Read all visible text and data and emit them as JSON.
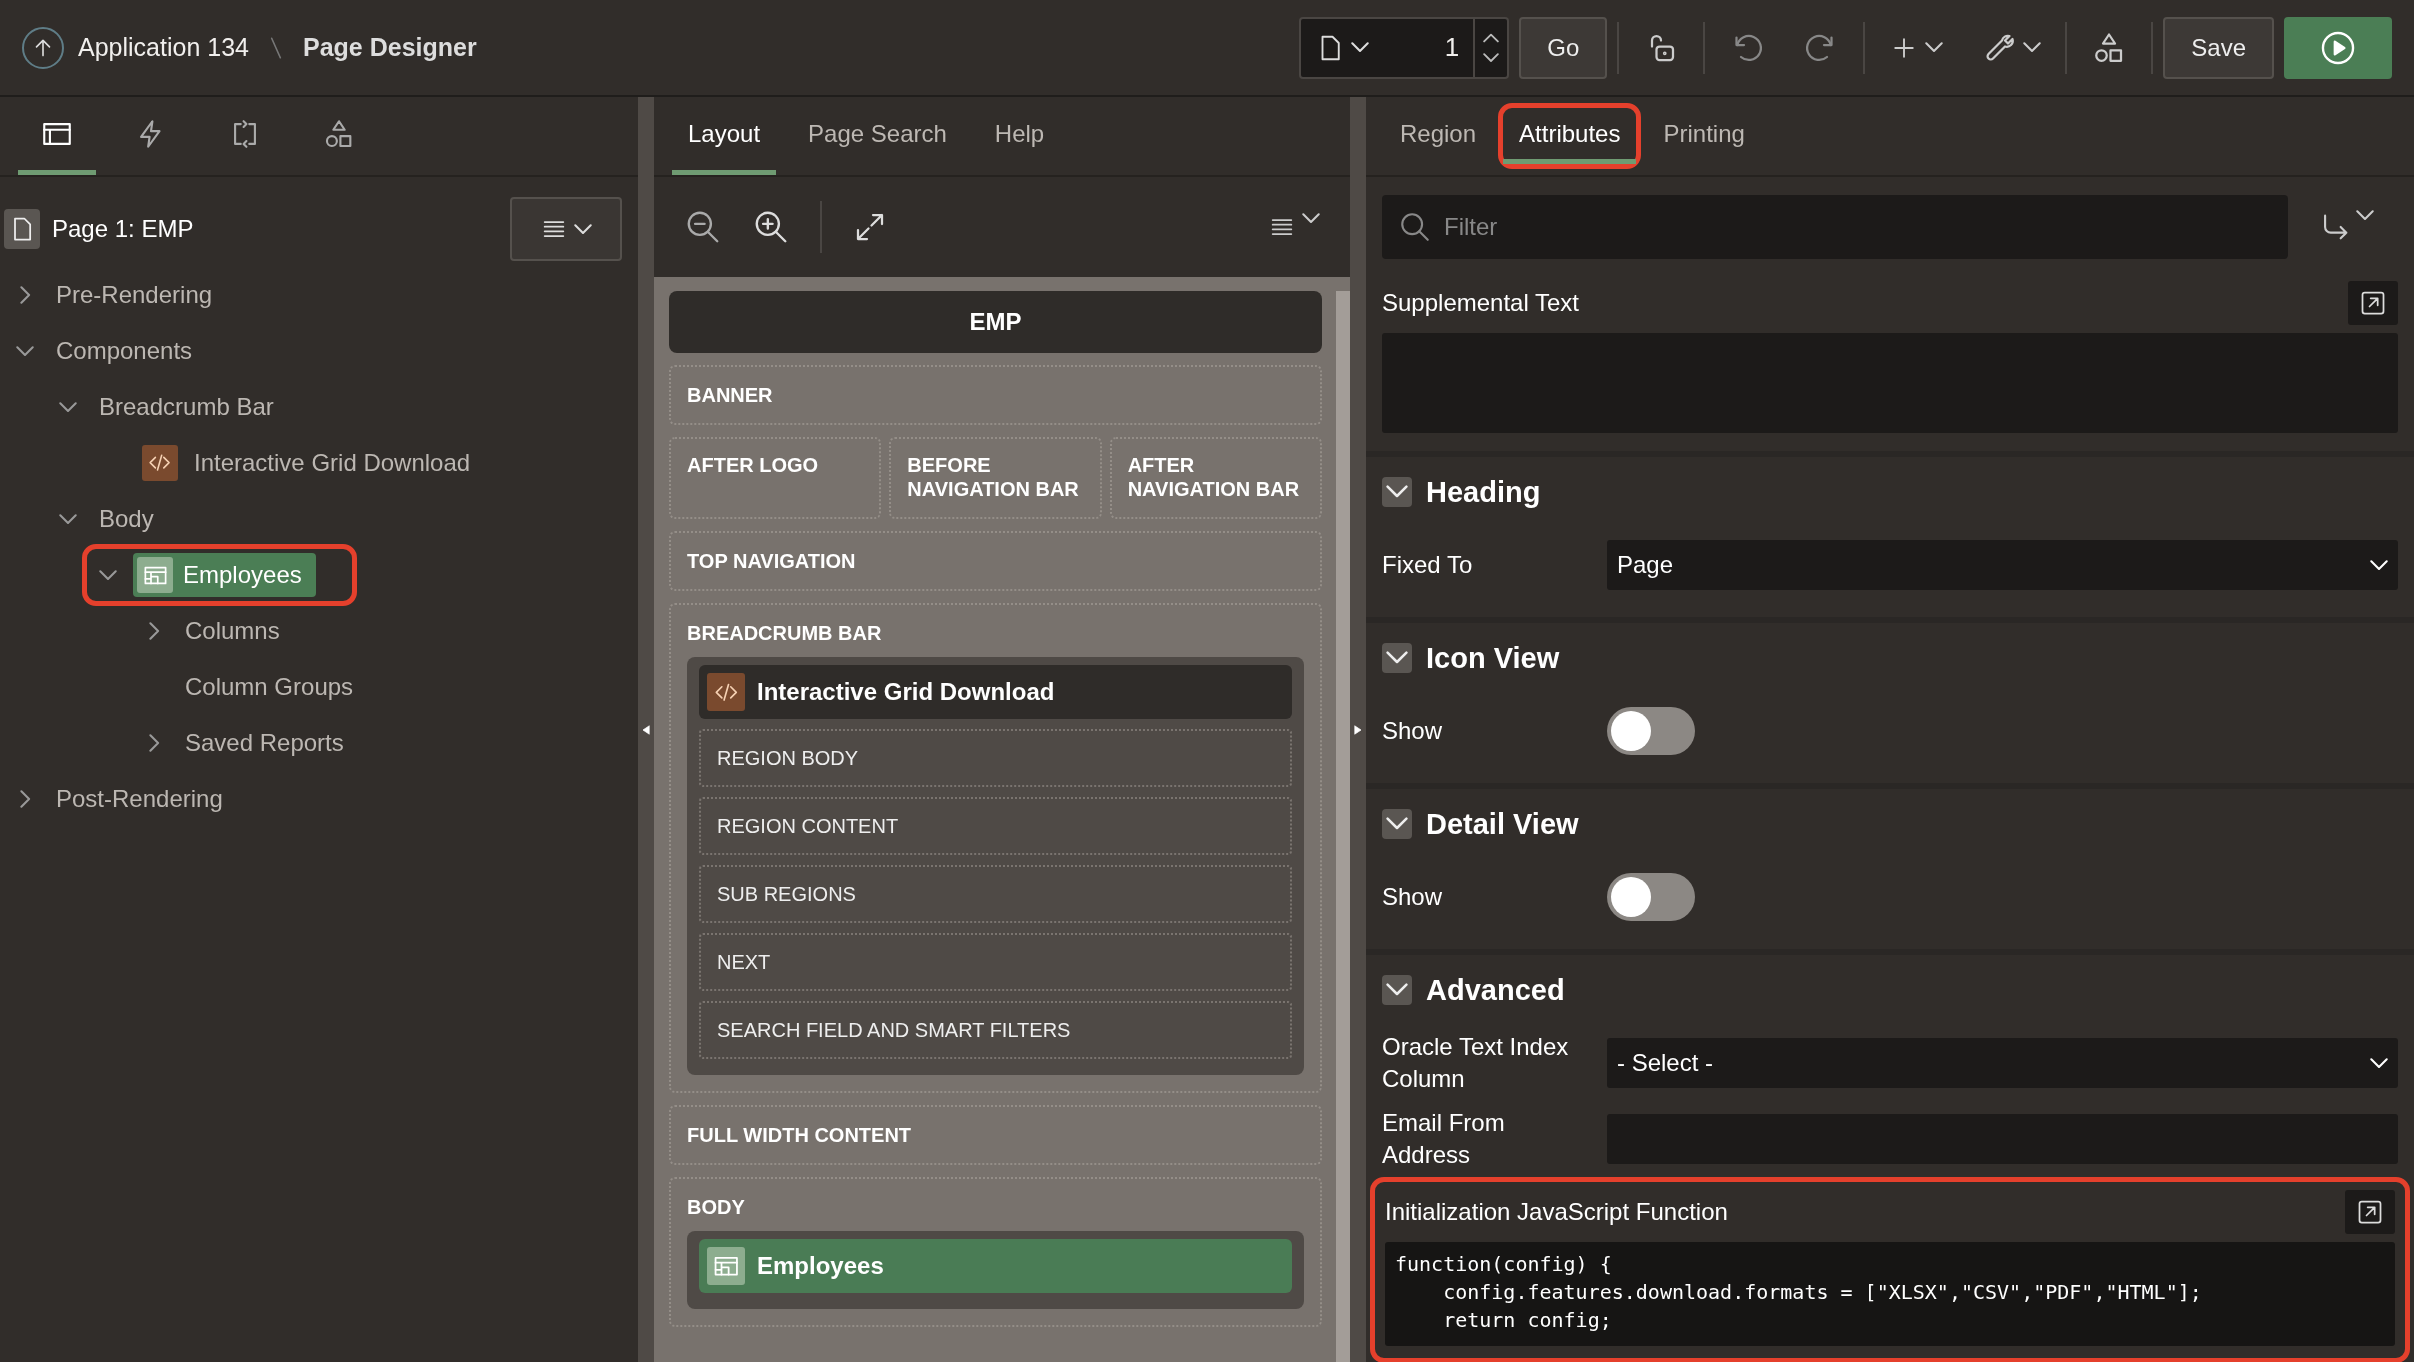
{
  "header": {
    "app": "Application 134",
    "page_title": "Page Designer"
  },
  "toolbar": {
    "page_number": "1",
    "go": "Go",
    "save": "Save"
  },
  "left": {
    "tabs": [
      {
        "kind": "rendering",
        "selected": true
      },
      {
        "kind": "dynamic",
        "selected": false
      },
      {
        "kind": "processing",
        "selected": false
      },
      {
        "kind": "shared",
        "selected": false
      }
    ],
    "page_label": "Page 1: EMP",
    "tree": [
      {
        "label": "Pre-Rendering",
        "expanded": false
      },
      {
        "label": "Components",
        "expanded": true,
        "children": [
          {
            "label": "Breadcrumb Bar",
            "expanded": true,
            "children": [
              {
                "label": "Interactive Grid Download",
                "kind": "code",
                "selected": false,
                "highlighted": false
              }
            ]
          },
          {
            "label": "Body",
            "expanded": true,
            "children": [
              {
                "label": "Employees",
                "kind": "grid",
                "expanded": true,
                "selected": true,
                "highlighted": true,
                "children": [
                  {
                    "label": "Columns",
                    "expanded": false
                  },
                  {
                    "label": "Column Groups"
                  },
                  {
                    "label": "Saved Reports",
                    "expanded": false
                  }
                ]
              }
            ]
          }
        ]
      },
      {
        "label": "Post-Rendering",
        "expanded": false
      }
    ]
  },
  "middle": {
    "tabs": [
      {
        "label": "Layout",
        "selected": true
      },
      {
        "label": "Page Search",
        "selected": false
      },
      {
        "label": "Help",
        "selected": false
      }
    ],
    "page_title": "EMP",
    "slots": [
      {
        "kind": "slot",
        "label": "BANNER"
      },
      {
        "kind": "row",
        "items": [
          "AFTER LOGO",
          "BEFORE NAVIGATION BAR",
          "AFTER NAVIGATION BAR"
        ]
      },
      {
        "kind": "slot",
        "label": "TOP NAVIGATION"
      },
      {
        "kind": "slot",
        "label": "BREADCRUMB BAR",
        "region": {
          "label": "Interactive Grid Download",
          "kind": "code",
          "selected": false,
          "subslots": [
            "REGION BODY",
            "REGION CONTENT",
            "SUB REGIONS",
            "NEXT",
            "SEARCH FIELD AND SMART FILTERS"
          ]
        }
      },
      {
        "kind": "slot",
        "label": "FULL WIDTH CONTENT"
      },
      {
        "kind": "slot",
        "label": "BODY",
        "region": {
          "label": "Employees",
          "kind": "grid",
          "selected": true
        }
      }
    ]
  },
  "right": {
    "tabs": [
      {
        "label": "Region",
        "selected": false,
        "highlighted": false
      },
      {
        "label": "Attributes",
        "selected": true,
        "highlighted": true
      },
      {
        "label": "Printing",
        "selected": false,
        "highlighted": false
      }
    ],
    "filter_placeholder": "Filter",
    "top_properties": [
      {
        "kind": "textarea",
        "label": "Supplemental Text"
      }
    ],
    "groups": [
      {
        "title": "Heading",
        "expanded": true,
        "properties": [
          {
            "kind": "select",
            "label": "Fixed To",
            "value": "Page"
          }
        ]
      },
      {
        "title": "Icon View",
        "expanded": true,
        "properties": [
          {
            "kind": "switch",
            "label": "Show",
            "on": false
          }
        ]
      },
      {
        "title": "Detail View",
        "expanded": true,
        "properties": [
          {
            "kind": "switch",
            "label": "Show",
            "on": false
          }
        ]
      },
      {
        "title": "Advanced",
        "expanded": true,
        "properties": [
          {
            "kind": "select",
            "label": "Oracle Text Index Column",
            "value": "- Select -"
          },
          {
            "kind": "text",
            "label": "Email From Address"
          },
          {
            "kind": "code",
            "label": "Initialization JavaScript Function",
            "highlighted": true,
            "lines": [
              "function(config) {",
              "    config.features.download.formats = [\"XLSX\",\"CSV\",\"PDF\",\"HTML\"];",
              "    return config;"
            ]
          }
        ]
      }
    ]
  }
}
